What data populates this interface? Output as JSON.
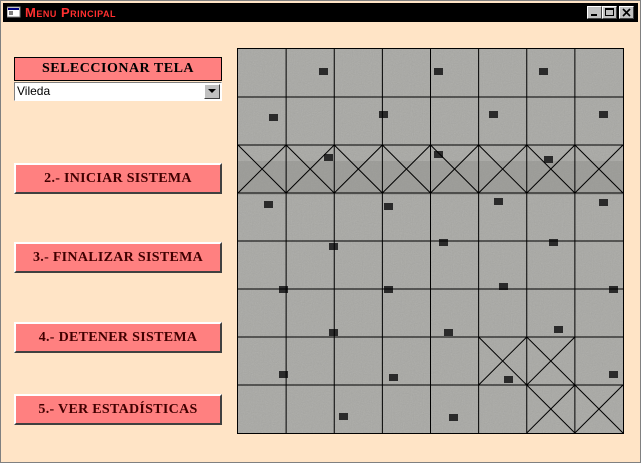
{
  "window": {
    "title": "Menu Principal"
  },
  "panel": {
    "select_label": "SELECCIONAR TELA",
    "fabric_select": {
      "value": "Vileda",
      "options": [
        "Vileda"
      ]
    },
    "buttons": {
      "start": "2.- INICIAR SISTEMA",
      "finish": "3.- FINALIZAR SISTEMA",
      "stop": "4.- DETENER SISTEMA",
      "stats": "5.- VER ESTADÍSTICAS"
    }
  },
  "fabric_grid": {
    "rows": 8,
    "cols": 8,
    "defect_cells": [
      [
        2,
        0
      ],
      [
        2,
        1
      ],
      [
        2,
        2
      ],
      [
        2,
        3
      ],
      [
        2,
        4
      ],
      [
        2,
        5
      ],
      [
        2,
        6
      ],
      [
        2,
        7
      ],
      [
        6,
        5
      ],
      [
        6,
        6
      ],
      [
        7,
        6
      ],
      [
        7,
        7
      ]
    ]
  },
  "colors": {
    "background": "#ffe4c6",
    "button": "#ff8080",
    "title_text": "#ff3030",
    "titlebar": "#000000",
    "fabric": "#a8a8a4"
  }
}
